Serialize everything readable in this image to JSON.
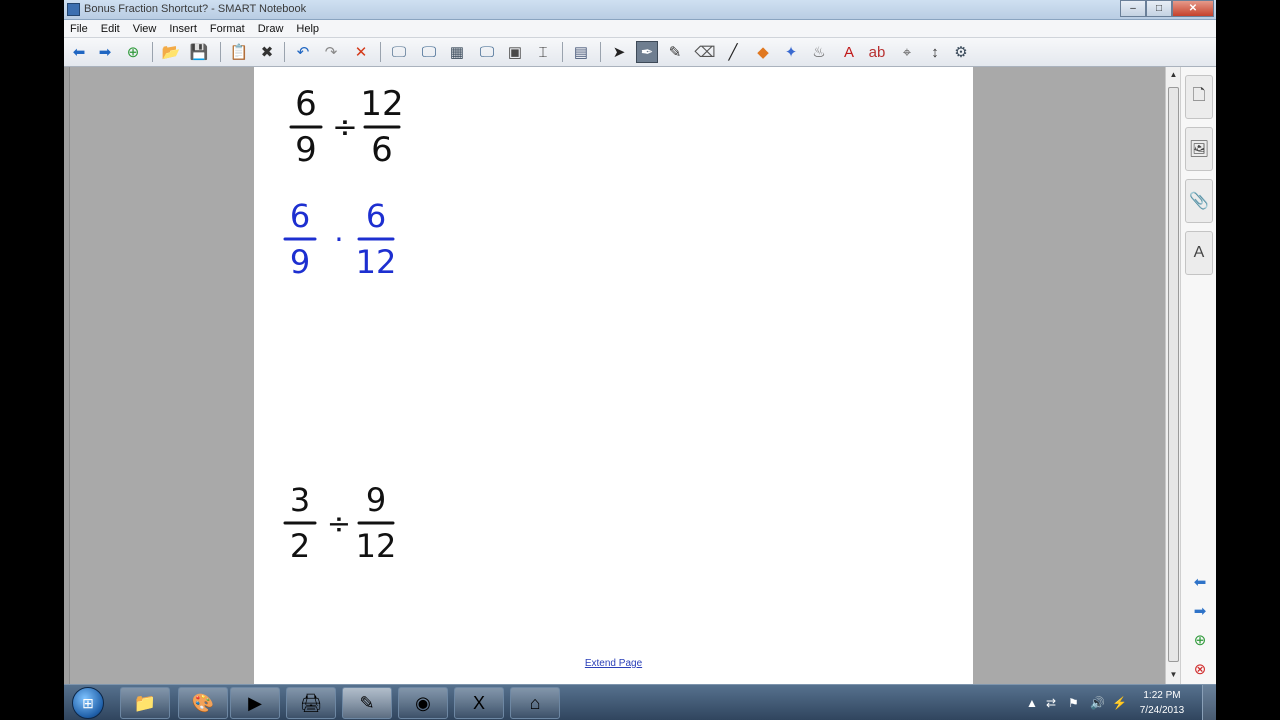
{
  "window": {
    "title": "Bonus Fraction Shortcut? - SMART Notebook",
    "minimize": "–",
    "maximize": "□",
    "close": "✕"
  },
  "menu": [
    "File",
    "Edit",
    "View",
    "Insert",
    "Format",
    "Draw",
    "Help"
  ],
  "toolbar": {
    "icons": [
      {
        "name": "back-icon",
        "glyph": "⬅",
        "color": "#1f66c2"
      },
      {
        "name": "forward-icon",
        "glyph": "➡",
        "color": "#1f66c2"
      },
      {
        "name": "add-page-icon",
        "glyph": "⊕",
        "color": "#2f9a3a"
      },
      {
        "name": "open-file-icon",
        "glyph": "📂",
        "color": "#c89020"
      },
      {
        "name": "save-icon",
        "glyph": "💾",
        "color": "#3b5a8a"
      },
      {
        "name": "paste-icon",
        "glyph": "📋",
        "color": "#555555"
      },
      {
        "name": "delete-icon",
        "glyph": "✖",
        "color": "#333333"
      },
      {
        "name": "undo-icon",
        "glyph": "↶",
        "color": "#1f66c2"
      },
      {
        "name": "redo-icon",
        "glyph": "↷",
        "color": "#8a8a8a"
      },
      {
        "name": "clear-icon",
        "glyph": "✕",
        "color": "#d43a1a"
      },
      {
        "name": "screen-shade-icon",
        "glyph": "🖵",
        "color": "#4a6a8a"
      },
      {
        "name": "full-screen-icon",
        "glyph": "🖵",
        "color": "#2f5a86"
      },
      {
        "name": "transparent-bg-icon",
        "glyph": "▦",
        "color": "#3a4a5a"
      },
      {
        "name": "dual-page-icon",
        "glyph": "🖵",
        "color": "#2f5a86"
      },
      {
        "name": "screen-capture-icon",
        "glyph": "▣",
        "color": "#4a4a4a"
      },
      {
        "name": "document-camera-icon",
        "glyph": "⌶",
        "color": "#333333"
      },
      {
        "name": "table-icon",
        "glyph": "▤",
        "color": "#4a5a7a"
      },
      {
        "name": "select-icon",
        "glyph": "➤",
        "color": "#222222"
      },
      {
        "name": "pen-icon",
        "glyph": "✒",
        "color": "#ffffff"
      },
      {
        "name": "creative-pen-icon",
        "glyph": "✎",
        "color": "#333333"
      },
      {
        "name": "eraser-icon",
        "glyph": "⌫",
        "color": "#555555"
      },
      {
        "name": "line-icon",
        "glyph": "╱",
        "color": "#222222"
      },
      {
        "name": "shapes-icon",
        "glyph": "◆",
        "color": "#e07820"
      },
      {
        "name": "magic-pen-icon",
        "glyph": "✦",
        "color": "#3a6ad0"
      },
      {
        "name": "fill-icon",
        "glyph": "♨",
        "color": "#555555"
      },
      {
        "name": "text-icon",
        "glyph": "A",
        "color": "#c01818"
      },
      {
        "name": "recognize-icon",
        "glyph": "ab",
        "color": "#b83030"
      },
      {
        "name": "properties-icon",
        "glyph": "⌖",
        "color": "#555555"
      },
      {
        "name": "move-toolbar-icon",
        "glyph": "↕",
        "color": "#333333"
      },
      {
        "name": "customize-icon",
        "glyph": "⚙",
        "color": "#3a4a5a"
      }
    ]
  },
  "page": {
    "extend_label": "Extend Page",
    "problems": [
      {
        "color": "#111111",
        "num": "6",
        "den": "9",
        "op": "÷",
        "num2": "12",
        "den2": "6"
      },
      {
        "color": "#1d2fd0",
        "num": "6",
        "den": "9",
        "op": "·",
        "num2": "6",
        "den2": "12"
      },
      {
        "color": "#111111",
        "num": "3",
        "den": "2",
        "op": "÷",
        "num2": "9",
        "den2": "12"
      }
    ]
  },
  "side_tabs": [
    {
      "name": "page-sorter-tab",
      "glyph": "🗋"
    },
    {
      "name": "gallery-tab",
      "glyph": "🖼"
    },
    {
      "name": "attachments-tab",
      "glyph": "📎"
    },
    {
      "name": "properties-tab",
      "glyph": "A"
    }
  ],
  "side_nav": [
    {
      "name": "previous-page-icon",
      "glyph": "⬅",
      "color": "#2f73c8"
    },
    {
      "name": "next-page-icon",
      "glyph": "➡",
      "color": "#2f73c8"
    },
    {
      "name": "add-page-side-icon",
      "glyph": "⊕",
      "color": "#2f9a3a"
    },
    {
      "name": "delete-page-icon",
      "glyph": "⊗",
      "color": "#d02a2a"
    }
  ],
  "taskbar": {
    "start": "⊞",
    "apps": [
      {
        "name": "taskbar-explorer",
        "glyph": "📁"
      },
      {
        "name": "taskbar-paint",
        "glyph": "🎨"
      },
      {
        "name": "taskbar-media-player",
        "glyph": "▶"
      },
      {
        "name": "taskbar-printer",
        "glyph": "🖨"
      },
      {
        "name": "taskbar-smart-notebook",
        "glyph": "✎",
        "active": true
      },
      {
        "name": "taskbar-chrome",
        "glyph": "◉"
      },
      {
        "name": "taskbar-excel",
        "glyph": "X"
      },
      {
        "name": "taskbar-app",
        "glyph": "⌂"
      }
    ],
    "tray": [
      "▲",
      "⇄",
      "⚑",
      "🔊",
      "⚡"
    ],
    "time": "1:22 PM",
    "date": "7/24/2013"
  }
}
